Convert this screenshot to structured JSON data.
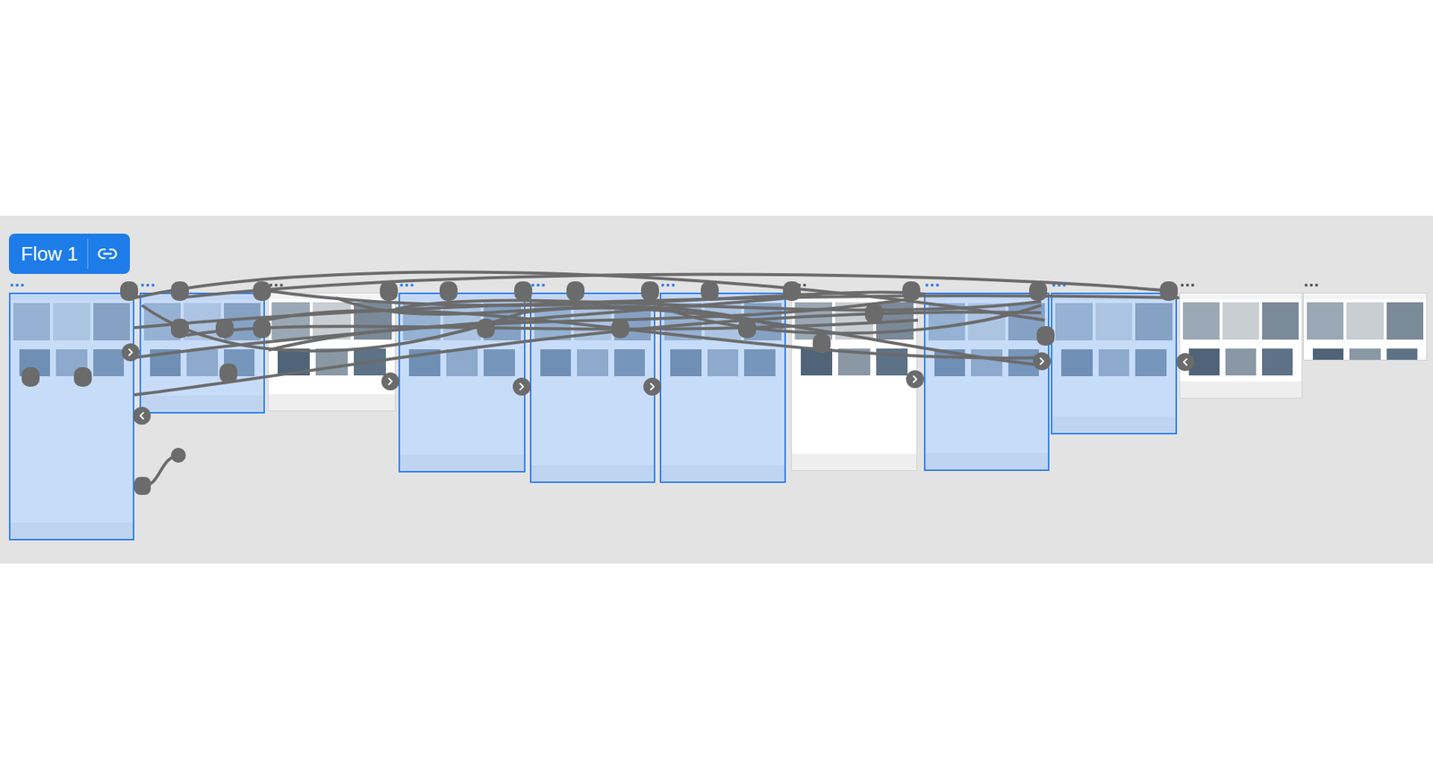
{
  "flow": {
    "label": "Flow 1"
  },
  "frames": [
    {
      "selected": true
    },
    {
      "selected": true
    },
    {
      "selected": false
    },
    {
      "selected": true
    },
    {
      "selected": true
    },
    {
      "selected": true
    },
    {
      "selected": false
    },
    {
      "selected": true
    },
    {
      "selected": true
    },
    {
      "selected": false
    },
    {
      "selected": false
    }
  ]
}
